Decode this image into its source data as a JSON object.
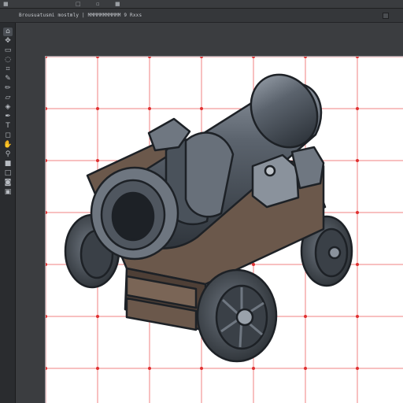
{
  "document": {
    "title": "Brousuatusmi mostmly | MMMMMMMMMMM 9 Rxxs"
  },
  "menubar": {
    "glyphs": [
      "■",
      "□",
      "▫",
      "■"
    ]
  },
  "toolbar": {
    "tools": [
      {
        "name": "home-icon",
        "glyph": "⌂"
      },
      {
        "name": "move-icon",
        "glyph": "✥"
      },
      {
        "name": "marquee-icon",
        "glyph": "▭"
      },
      {
        "name": "lasso-icon",
        "glyph": "◌"
      },
      {
        "name": "crop-icon",
        "glyph": "⌗"
      },
      {
        "name": "eyedropper-icon",
        "glyph": "✎"
      },
      {
        "name": "brush-icon",
        "glyph": "✏"
      },
      {
        "name": "eraser-icon",
        "glyph": "▱"
      },
      {
        "name": "fill-icon",
        "glyph": "◈"
      },
      {
        "name": "pen-icon",
        "glyph": "✒"
      },
      {
        "name": "text-icon",
        "glyph": "T"
      },
      {
        "name": "shape-icon",
        "glyph": "◻"
      },
      {
        "name": "hand-icon",
        "glyph": "✋"
      },
      {
        "name": "zoom-icon",
        "glyph": "⚲"
      },
      {
        "name": "foreground-color-icon",
        "glyph": "■"
      },
      {
        "name": "background-color-icon",
        "glyph": "□"
      },
      {
        "name": "quickmask-icon",
        "glyph": "◙"
      },
      {
        "name": "screenmode-icon",
        "glyph": "▣"
      }
    ]
  },
  "canvas": {
    "grid_color": "#f08080",
    "grid_dot_color": "#e03030",
    "subject": "cannon"
  }
}
